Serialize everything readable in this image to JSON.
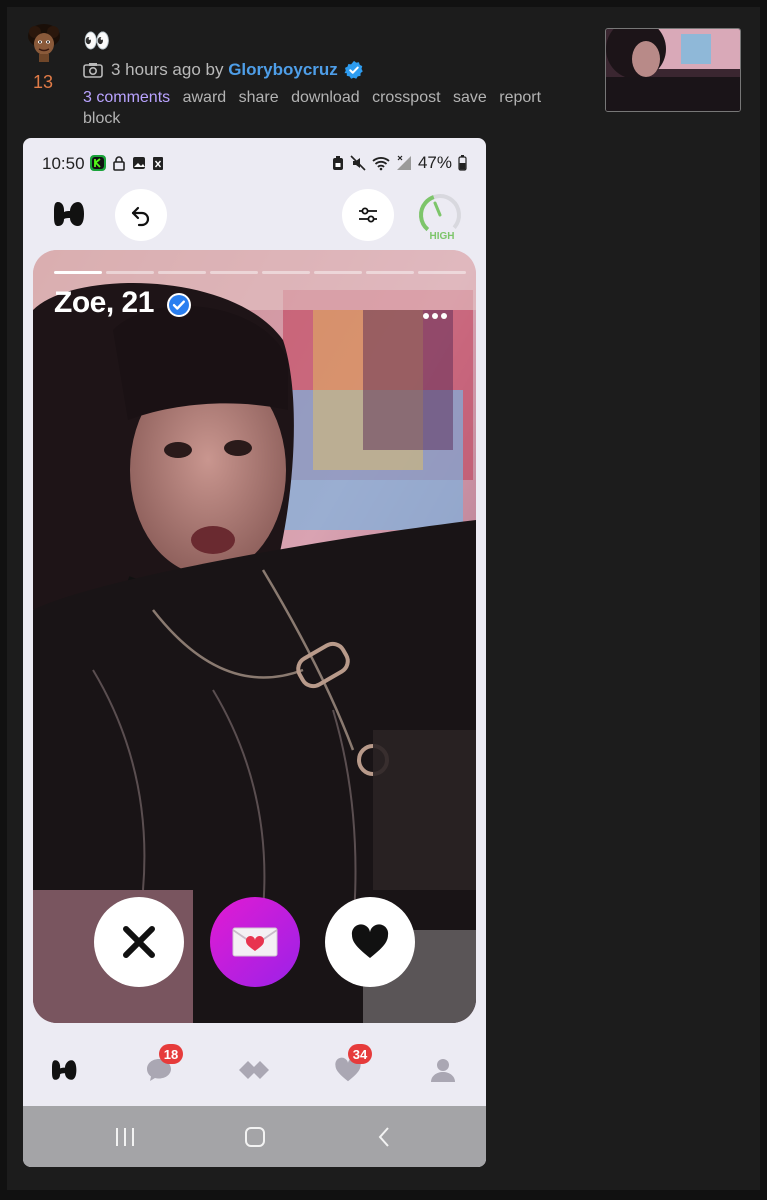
{
  "post": {
    "score": "13",
    "title": "👀",
    "time_ago": "3 hours ago by",
    "author": "Gloryboycruz",
    "actions": [
      "3 comments",
      "award",
      "share",
      "download",
      "crosspost",
      "save",
      "report",
      "block"
    ]
  },
  "screenshot": {
    "status_bar": {
      "time": "10:50",
      "battery": "47%"
    },
    "gauge_label": "HIGH",
    "profile": {
      "name": "Zoe, 21",
      "photo_count": 8,
      "active_photo": 1
    },
    "tabs": [
      {
        "name": "home",
        "badge": ""
      },
      {
        "name": "messages",
        "badge": "18"
      },
      {
        "name": "matches",
        "badge": ""
      },
      {
        "name": "likes",
        "badge": "34"
      },
      {
        "name": "profile",
        "badge": ""
      }
    ]
  },
  "colors": {
    "score": "#e07b47",
    "author": "#4e9ee8",
    "comments": "#b9a3ff",
    "badge": "#e63b3b",
    "gauge": "#7dc56a",
    "message_button": "#c21fdc"
  }
}
